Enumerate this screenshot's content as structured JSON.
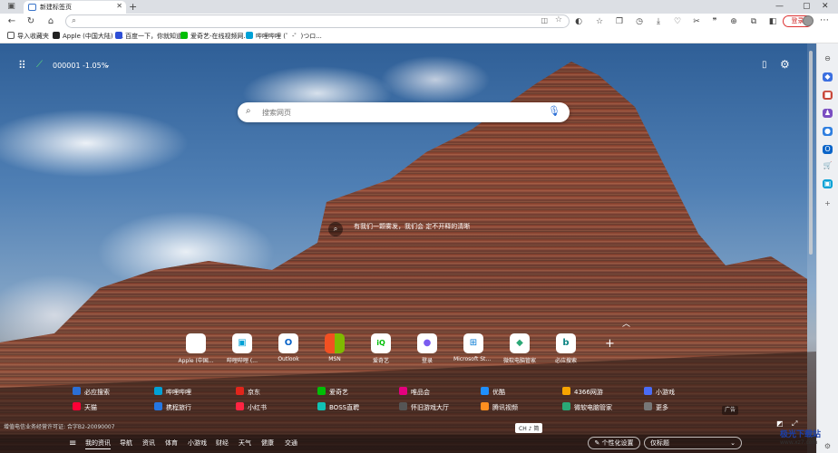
{
  "tab": {
    "title": "新建标签页"
  },
  "addressbar": {
    "placeholder": ""
  },
  "toolbar": {
    "login_label": "登录"
  },
  "bookmarks": [
    {
      "label": "导入收藏夹",
      "color": "#444"
    },
    {
      "label": "Apple (中国大陆) -...",
      "color": "#222"
    },
    {
      "label": "百度一下，你就知道",
      "color": "#2e4fd6"
    },
    {
      "label": "爱奇艺-在线视频网...",
      "color": "#00be06"
    },
    {
      "label": "哔哩哔哩 (゜-゜)つロ...",
      "color": "#00a1d6"
    }
  ],
  "widgets": {
    "stock_code": "000001",
    "stock_change": "-1.05%"
  },
  "search": {
    "placeholder": "搜索网页"
  },
  "caption": {
    "text": "有我们一颗雾发，我们会 定不开释的清晰"
  },
  "tiles": [
    {
      "label": "Apple (中国...",
      "glyph": "",
      "color": "#111"
    },
    {
      "label": "哔哩哔哩 (...",
      "glyph": "▣",
      "color": "#00a1d6"
    },
    {
      "label": "Outlook",
      "glyph": "O",
      "color": "#0a64c8"
    },
    {
      "label": "MSN",
      "glyph": "■",
      "color": "#f25022"
    },
    {
      "label": "爱奇艺",
      "glyph": "iQ",
      "color": "#00be06"
    },
    {
      "label": "登录",
      "glyph": "●",
      "color": "#7b5cf0"
    },
    {
      "label": "Microsoft Sto...",
      "glyph": "⊞",
      "color": "#0078d4"
    },
    {
      "label": "微软电脑管家",
      "glyph": "◆",
      "color": "#2aa876"
    },
    {
      "label": "必应搜索",
      "glyph": "b",
      "color": "#0c8484"
    }
  ],
  "links": [
    {
      "label": "必应搜索",
      "color": "#2b6fd6"
    },
    {
      "label": "哔哩哔哩",
      "color": "#00a1d6"
    },
    {
      "label": "京东",
      "color": "#e1251b"
    },
    {
      "label": "爱奇艺",
      "color": "#00be06"
    },
    {
      "label": "唯品会",
      "color": "#e4007f"
    },
    {
      "label": "优酷",
      "color": "#1f8ffb"
    },
    {
      "label": "4366网游",
      "color": "#f7a400"
    },
    {
      "label": "小游戏",
      "color": "#4a6cf7"
    },
    {
      "label": "天猫",
      "color": "#ff0036"
    },
    {
      "label": "携程旅行",
      "color": "#2577e3"
    },
    {
      "label": "小红书",
      "color": "#ff2442"
    },
    {
      "label": "BOSS直聘",
      "color": "#11c2b4"
    },
    {
      "label": "怀旧游戏大厅",
      "color": "#555"
    },
    {
      "label": "腾讯视频",
      "color": "#ff8f1f"
    },
    {
      "label": "微软电脑管家",
      "color": "#2aa876"
    },
    {
      "label": "更多",
      "color": "#777"
    }
  ],
  "ad_label": "广告",
  "icp": "增值电信业务经营许可证: 合字B2-20090007",
  "ime": "CH ♪ 简",
  "bottom_nav": [
    {
      "label": "我的资讯",
      "active": true
    },
    {
      "label": "导航",
      "active": false
    },
    {
      "label": "资讯",
      "active": false
    },
    {
      "label": "体育",
      "active": false
    },
    {
      "label": "小游戏",
      "active": false
    },
    {
      "label": "财经",
      "active": false
    },
    {
      "label": "天气",
      "active": false
    },
    {
      "label": "健康",
      "active": false
    },
    {
      "label": "交通",
      "active": false
    }
  ],
  "customize_label": "个性化设置",
  "dropdown_label": "仅标题",
  "watermark": "极光下载站",
  "watermark_sub": "www.xz7.com"
}
